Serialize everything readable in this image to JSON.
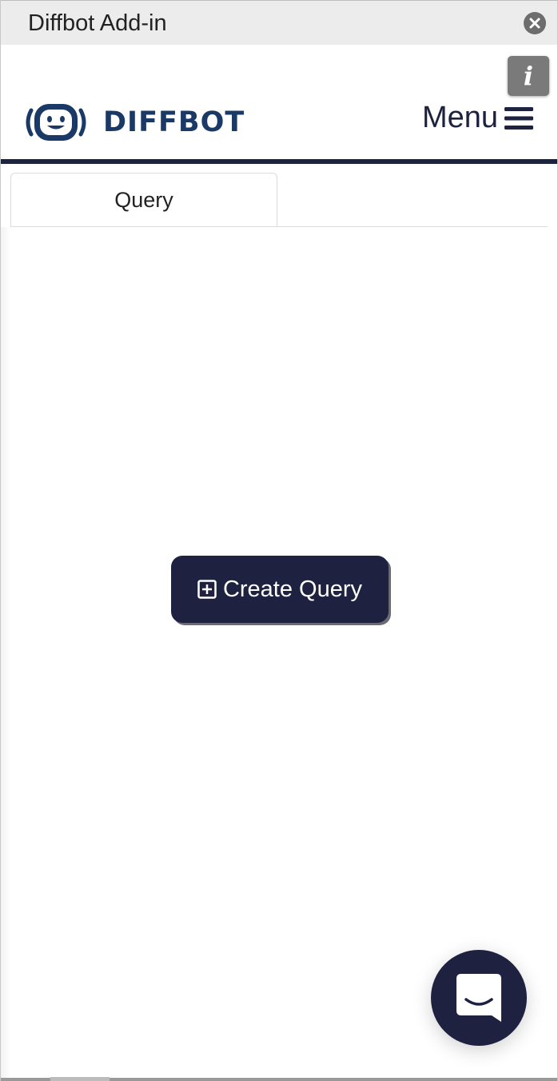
{
  "titlebar": {
    "title": "Diffbot Add-in",
    "close_icon": "close-icon"
  },
  "info_button": {
    "glyph": "i",
    "icon": "info-icon"
  },
  "header": {
    "logo_text": "DIFFBOT",
    "logo_icon": "robot-face-icon",
    "menu_label": "Menu",
    "menu_icon": "hamburger-icon"
  },
  "tabs": [
    {
      "label": "Query",
      "active": true
    }
  ],
  "main": {
    "create_button_label": "Create Query",
    "create_button_icon": "plus-square-icon"
  },
  "chat": {
    "icon": "chat-icon"
  },
  "colors": {
    "brand_navy": "#1e2240",
    "logo_blue": "#1a3966",
    "titlebar_bg": "#ececec"
  }
}
